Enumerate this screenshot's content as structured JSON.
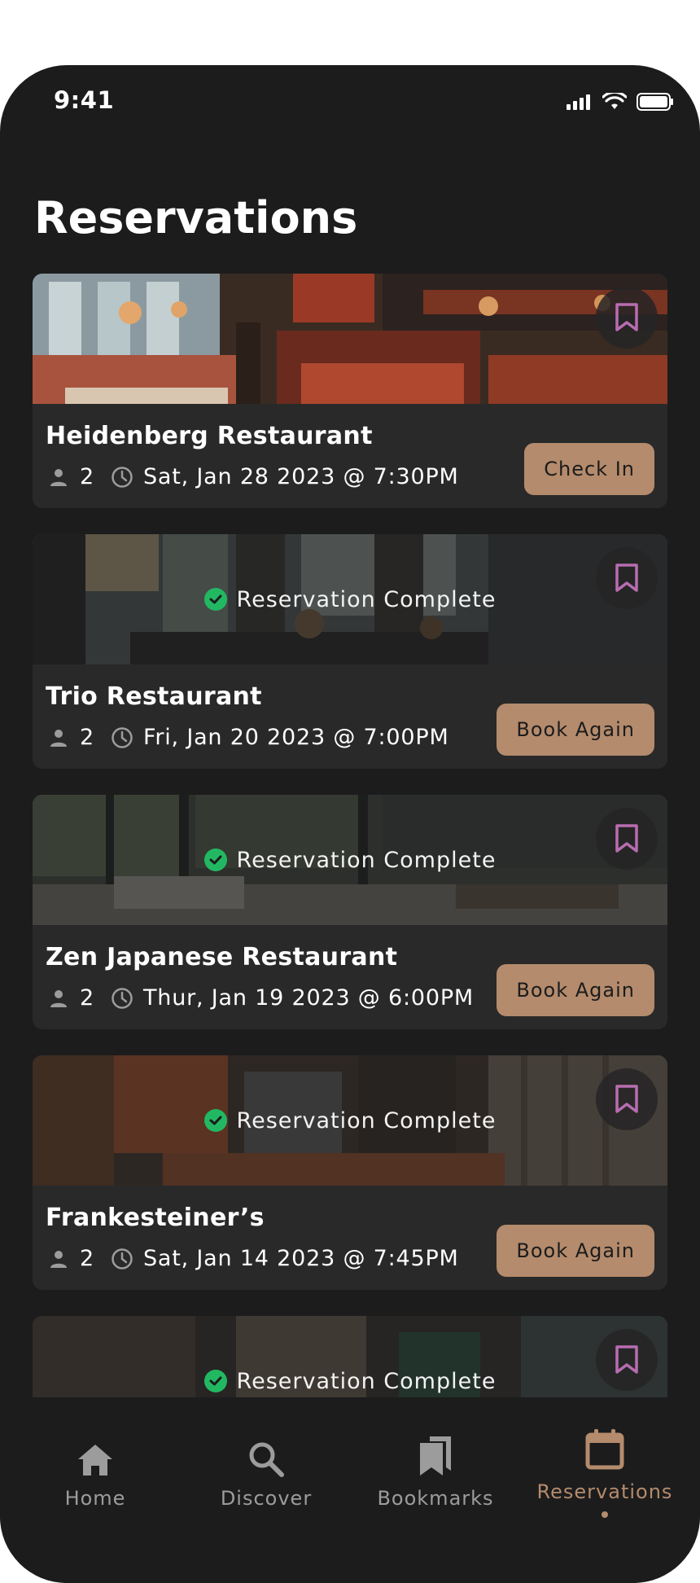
{
  "status": {
    "time": "9:41"
  },
  "page": {
    "title": "Reservations"
  },
  "colors": {
    "accent": "#b48b6c",
    "bookmark": "#b86db0",
    "success": "#22b862",
    "background": "#1c1c1d",
    "card": "#29292a"
  },
  "reservations": [
    {
      "name": "Heidenberg Restaurant",
      "guests": "2",
      "datetime": "Sat, Jan 28 2023 @ 7:30PM",
      "action": "Check In",
      "status": ""
    },
    {
      "name": "Trio Restaurant",
      "guests": "2",
      "datetime": "Fri, Jan 20 2023 @ 7:00PM",
      "action": "Book Again",
      "status": "Reservation Complete"
    },
    {
      "name": "Zen Japanese Restaurant",
      "guests": "2",
      "datetime": "Thur, Jan 19 2023 @ 6:00PM",
      "action": "Book Again",
      "status": "Reservation Complete"
    },
    {
      "name": "Frankesteiner’s",
      "guests": "2",
      "datetime": "Sat, Jan 14 2023 @ 7:45PM",
      "action": "Book Again",
      "status": "Reservation Complete"
    },
    {
      "name": "",
      "guests": "",
      "datetime": "",
      "action": "",
      "status": "Reservation Complete"
    }
  ],
  "tabs": [
    {
      "label": "Home",
      "icon": "home-icon"
    },
    {
      "label": "Discover",
      "icon": "search-icon"
    },
    {
      "label": "Bookmarks",
      "icon": "bookmarks-icon"
    },
    {
      "label": "Reservations",
      "icon": "calendar-icon",
      "active": true
    }
  ]
}
